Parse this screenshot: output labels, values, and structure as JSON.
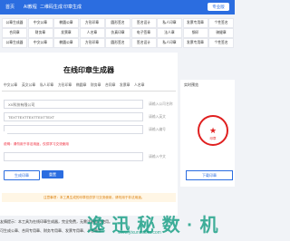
{
  "nav": {
    "items": [
      "首页",
      "AI教程",
      "二维码生成",
      "印章生成"
    ],
    "login": "专业版"
  },
  "grid": {
    "rows": [
      [
        "公章生成器",
        "中文公章",
        "椭圆公章",
        "方形印章",
        "圆形签名",
        "签名设计",
        "私人印章",
        "发票专用章",
        "个性签名"
      ],
      [
        "合同章",
        "财务章",
        "发票章",
        "人名章",
        "仿真印章",
        "电子签章",
        "法人章",
        "钢印",
        "骑缝章"
      ],
      [
        "公章生成器",
        "中文公章",
        "椭圆公章",
        "方形印章",
        "圆形签名",
        "签名设计",
        "私人印章",
        "发票专用章",
        "个性签名"
      ]
    ]
  },
  "main": {
    "title": "在线印章生成器",
    "tabs": [
      "中文公章",
      "英文公章",
      "私人印章",
      "方形印章",
      "椭圆章",
      "财务章",
      "合同章",
      "发票章",
      "人名章"
    ],
    "fields": [
      {
        "value": "XX科技有限公司",
        "hint": "请输入公司名称"
      },
      {
        "value": "TEXTTEXTTEXTTEXTTEXT",
        "hint": "请输入英文"
      },
      {
        "value": "",
        "hint": "请输入编号"
      },
      {
        "value": "",
        "hint": "请输入中文"
      }
    ],
    "check_text": "说明：请勿用于非法用途，仅供学习交流使用",
    "btn_generate": "生成印章",
    "btn_reset": "重置",
    "notice": "注意事项：本工具生成的印章仅供学习交流使用，请勿用于非法用途。"
  },
  "side": {
    "title": "实时预览",
    "stamp_text": "印章",
    "download": "下载印章"
  },
  "bottom": {
    "line1": "友情提示：本工具为在线印章生成器，完全免费，无需注册即可使用。",
    "line2": "可生成公章、合同专用章、财务专用章、发票专用章、人名章等。"
  },
  "watermark": {
    "main": "逸 迅 秘 数 · 机",
    "sub": "www.yixunmishu.com"
  },
  "colors": {
    "accent": "#2b6de0",
    "stamp": "#e02020",
    "notice": "#d97a00"
  }
}
